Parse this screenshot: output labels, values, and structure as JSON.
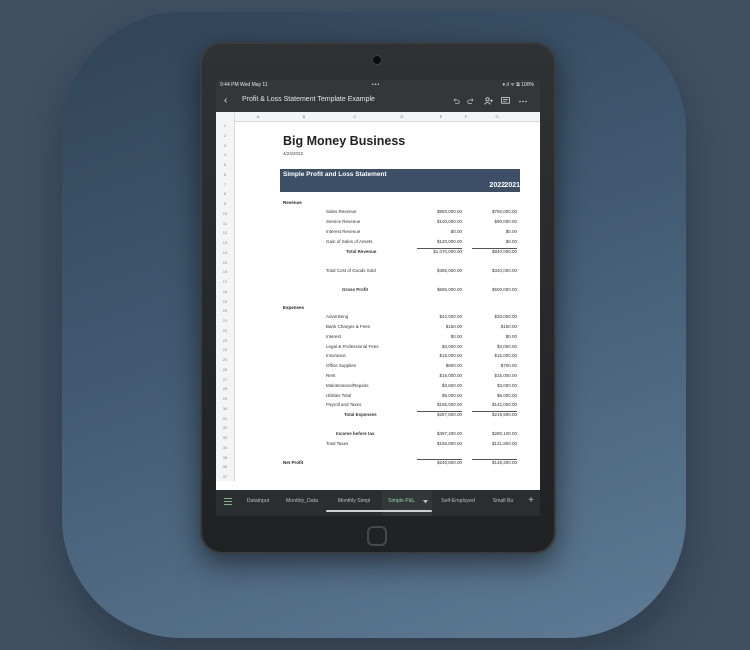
{
  "status": {
    "time": "9:44 PM  Wed May 11",
    "dots": "•••",
    "system": "⁠▾.ıl ᯤ ⧉ 100%"
  },
  "toolbar": {
    "back": "‹",
    "title": "Profit & Loss Statement Template Example"
  },
  "columns": [
    "A",
    "B",
    "C",
    "D",
    "E",
    "F",
    "G"
  ],
  "rows": [
    "1",
    "2",
    "3",
    "4",
    "5",
    "6",
    "7",
    "8",
    "9",
    "10",
    "11",
    "12",
    "13",
    "14",
    "15",
    "16",
    "17",
    "18",
    "19",
    "20",
    "21",
    "22",
    "23",
    "24",
    "25",
    "26",
    "27",
    "28",
    "29",
    "30",
    "31",
    "32",
    "33",
    "34",
    "35",
    "36",
    "37"
  ],
  "sheet": {
    "title": "Big Money Business",
    "date": "4/23/2022",
    "banner_title": "Simple Profit and Loss Statement",
    "year1": "2022",
    "year2": "2021",
    "revenue_label": "Revenue",
    "expenses_label": "Expenses",
    "net_profit_label": "Net Profit",
    "lines": {
      "sales_revenue": {
        "label": "Sales Revenue",
        "v1": "$850,000.00",
        "v2": "$750,000.00"
      },
      "service_revenue": {
        "label": "Service Revenue",
        "v1": "$100,000.00",
        "v2": "$90,000.00"
      },
      "interest_revenue": {
        "label": "Interest Revenue",
        "v1": "$0.00",
        "v2": "$0.00"
      },
      "gain_sales_assets": {
        "label": "Gain of Sales of Assets",
        "v1": "$120,000.00",
        "v2": "$0.00"
      },
      "total_revenue": {
        "label": "Total Revenue",
        "v1": "$1,070,000.00",
        "v2": "$840,000.00"
      },
      "cogs": {
        "label": "Total Cost of Goods Sold",
        "v1": "$385,000.00",
        "v2": "$340,000.00"
      },
      "gross_profit": {
        "label": "Gross Profit",
        "v1": "$685,000.00",
        "v2": "$500,000.00"
      },
      "advertising": {
        "label": "Advertising",
        "v1": "$42,000.00",
        "v2": "$30,000.00"
      },
      "bank_charges": {
        "label": "Bank Charges & Fees",
        "v1": "$150.00",
        "v2": "$150.00"
      },
      "interest": {
        "label": "Interest",
        "v1": "$0.00",
        "v2": "$0.00"
      },
      "legal": {
        "label": "Legal & Professional Fees",
        "v1": "$3,000.00",
        "v2": "$3,000.00"
      },
      "insurance": {
        "label": "Insurance",
        "v1": "$18,000.00",
        "v2": "$15,000.00"
      },
      "office_supplies": {
        "label": "Office Supplies",
        "v1": "$800.00",
        "v2": "$700.00"
      },
      "rent": {
        "label": "Rent",
        "v1": "$16,000.00",
        "v2": "$15,000.00"
      },
      "maintenance": {
        "label": "Maintenance/Repairs",
        "v1": "$3,600.00",
        "v2": "$3,000.00"
      },
      "utilities": {
        "label": "Utilities Total",
        "v1": "$9,000.00",
        "v2": "$8,000.00"
      },
      "payroll": {
        "label": "Payroll and Taxes",
        "v1": "$195,000.00",
        "v2": "$142,000.00"
      },
      "total_expenses": {
        "label": "Total Expenses",
        "v1": "$287,600.00",
        "v2": "$219,900.00"
      },
      "income_before_tax": {
        "label": "Income before tax",
        "v1": "$397,400.00",
        "v2": "$280,100.00"
      },
      "total_taxes": {
        "label": "Total Taxes",
        "v1": "$156,800.00",
        "v2": "$131,800.00"
      },
      "net_profit": {
        "v1": "$240,600.00",
        "v2": "$148,300.00"
      }
    }
  },
  "tabs": {
    "t1": "DataInput",
    "t2": "Monthly_Data",
    "t3": "Monthly Simpl",
    "t4": "Simple P&L",
    "t5": "Self-Employed",
    "t6": "Small Bu"
  },
  "colors": {
    "banner": "#3d4f66",
    "active_tab": "#8fd29d",
    "background": "#3f5063"
  },
  "icons": [
    "menu-icon",
    "undo-icon",
    "redo-icon",
    "add-person-icon",
    "comment-icon",
    "more-icon",
    "plus-icon",
    "back-icon"
  ]
}
